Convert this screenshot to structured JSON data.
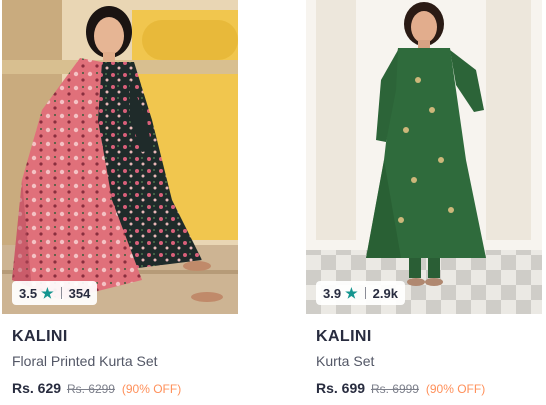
{
  "products": [
    {
      "image": "Model wearing a pink floral printed kurta with dupatta and dark printed palazzo",
      "rating": "3.5",
      "rating_count": "354",
      "brand": "KALINI",
      "name": "Floral Printed Kurta Set",
      "price": "Rs. 629",
      "mrp": "Rs. 6299",
      "discount": "(90% OFF)"
    },
    {
      "image": "Model wearing a green embroidered anarkali kurta set with sheer dupatta",
      "rating": "3.9",
      "rating_count": "2.9k",
      "brand": "KALINI",
      "name": "Kurta Set",
      "price": "Rs. 699",
      "mrp": "Rs. 6999",
      "discount": "(90% OFF)"
    }
  ],
  "icons": {
    "rating": "star-icon"
  },
  "colors": {
    "star": "#14958f",
    "discount": "#ff905a",
    "brand": "#282c3f",
    "pink_kurta": "#e0707a",
    "green_kurta": "#2f6b3c"
  }
}
